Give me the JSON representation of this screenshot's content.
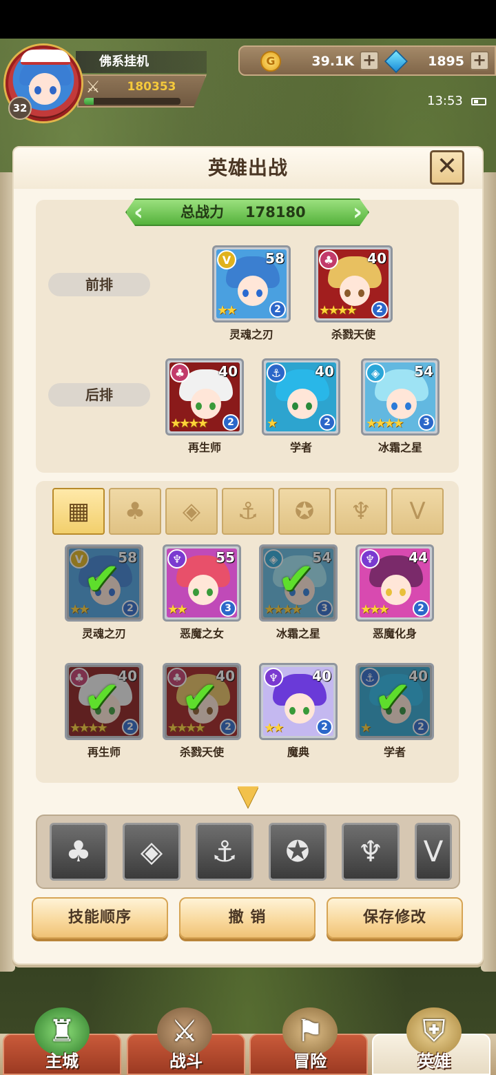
{
  "player": {
    "name": "佛系挂机",
    "level": "32",
    "power": "180353",
    "exp_progress": 0.1
  },
  "currency": {
    "gold": "39.1K",
    "gems": "1895"
  },
  "status": {
    "time": "13:53"
  },
  "dialog": {
    "title": "英雄出战",
    "close_icon": "✕"
  },
  "formation": {
    "total_power_label": "总战力",
    "total_power_value": "178180",
    "front_row_label": "前排",
    "back_row_label": "后排",
    "front": [
      {
        "name": "灵魂之刃",
        "level": "58",
        "stars": "★★",
        "awaken": "2",
        "faction": "dark",
        "faction_color": "#e0b21c",
        "hair": "#3b7fd0",
        "bg": "#4aa0e0",
        "eye": "#2a6ad0",
        "badge_glyph": "V"
      },
      {
        "name": "杀戮天使",
        "level": "40",
        "stars": "★★★★",
        "awaken": "2",
        "faction": "forest",
        "faction_color": "#c23a6a",
        "hair": "#e8c060",
        "bg": "#a11e1e",
        "eye": "#8a5a2a",
        "badge_glyph": "♣"
      }
    ],
    "back": [
      {
        "name": "再生师",
        "level": "40",
        "stars": "★★★★",
        "awaken": "2",
        "faction": "forest",
        "faction_color": "#c23a6a",
        "hair": "#f1f1f1",
        "bg": "#8a1a1a",
        "eye": "#3a9a3a",
        "badge_glyph": "♣"
      },
      {
        "name": "学者",
        "level": "40",
        "stars": "★",
        "awaken": "2",
        "faction": "anchor",
        "faction_color": "#2b67c9",
        "hair": "#29b7e8",
        "bg": "#2da4cf",
        "eye": "#2a8a3a",
        "badge_glyph": "⚓"
      },
      {
        "name": "冰霜之星",
        "level": "54",
        "stars": "★★★★",
        "awaken": "3",
        "faction": "ice",
        "faction_color": "#2aa6d8",
        "hair": "#9ee3f4",
        "bg": "#62b8e0",
        "eye": "#2a7ad8",
        "badge_glyph": "◈"
      }
    ]
  },
  "filters": {
    "tabs": [
      {
        "name": "all",
        "glyph": "▦"
      },
      {
        "name": "forest",
        "glyph": "♣"
      },
      {
        "name": "ice",
        "glyph": "◈"
      },
      {
        "name": "anchor",
        "glyph": "⚓"
      },
      {
        "name": "beast",
        "glyph": "✪"
      },
      {
        "name": "demon",
        "glyph": "♆"
      },
      {
        "name": "dark",
        "glyph": "V"
      }
    ]
  },
  "roster": [
    {
      "name": "灵魂之刃",
      "level": "58",
      "stars": "★★",
      "awaken": "2",
      "selected": true,
      "faction_color": "#e0b21c",
      "hair": "#3b7fd0",
      "bg": "#4aa0e0",
      "eye": "#2a6ad0",
      "badge_glyph": "V"
    },
    {
      "name": "恶魔之女",
      "level": "55",
      "stars": "★★",
      "awaken": "3",
      "selected": false,
      "faction_color": "#7a3ad0",
      "hair": "#e8506a",
      "bg": "#c04ab8",
      "eye": "#3a9a3a",
      "badge_glyph": "♆"
    },
    {
      "name": "冰霜之星",
      "level": "54",
      "stars": "★★★★",
      "awaken": "3",
      "selected": true,
      "faction_color": "#2aa6d8",
      "hair": "#9ee3f4",
      "bg": "#62b8e0",
      "eye": "#2a7ad8",
      "badge_glyph": "◈"
    },
    {
      "name": "恶魔化身",
      "level": "44",
      "stars": "★★★",
      "awaken": "2",
      "selected": false,
      "faction_color": "#7a3ad0",
      "hair": "#7a2a6a",
      "bg": "#d84ab0",
      "eye": "#e8c03a",
      "badge_glyph": "♆"
    },
    {
      "name": "再生师",
      "level": "40",
      "stars": "★★★★",
      "awaken": "2",
      "selected": true,
      "faction_color": "#c23a6a",
      "hair": "#f1f1f1",
      "bg": "#8a1a1a",
      "eye": "#3a9a3a",
      "badge_glyph": "♣"
    },
    {
      "name": "杀戮天使",
      "level": "40",
      "stars": "★★★★",
      "awaken": "2",
      "selected": true,
      "faction_color": "#c23a6a",
      "hair": "#e8c060",
      "bg": "#a11e1e",
      "eye": "#8a5a2a",
      "badge_glyph": "♣"
    },
    {
      "name": "魔典",
      "level": "40",
      "stars": "★★",
      "awaken": "2",
      "selected": false,
      "faction_color": "#7a3ad0",
      "hair": "#6a3ad8",
      "bg": "#c4b8f0",
      "eye": "#3a9a3a",
      "badge_glyph": "♆"
    },
    {
      "name": "学者",
      "level": "40",
      "stars": "★",
      "awaken": "2",
      "selected": true,
      "faction_color": "#2b67c9",
      "hair": "#29b7e8",
      "bg": "#2da4cf",
      "eye": "#2a8a3a",
      "badge_glyph": "⚓"
    }
  ],
  "faction_bar": [
    {
      "name": "forest",
      "glyph": "♣"
    },
    {
      "name": "ice",
      "glyph": "◈"
    },
    {
      "name": "anchor",
      "glyph": "⚓"
    },
    {
      "name": "beast",
      "glyph": "✪"
    },
    {
      "name": "demon",
      "glyph": "♆"
    },
    {
      "name": "dark",
      "glyph": "V"
    }
  ],
  "actions": {
    "skill_order": "技能顺序",
    "undo": "撤 销",
    "save": "保存修改"
  },
  "nav": {
    "main_city": "主城",
    "battle": "战斗",
    "adventure": "冒险",
    "heroes": "英雄"
  }
}
